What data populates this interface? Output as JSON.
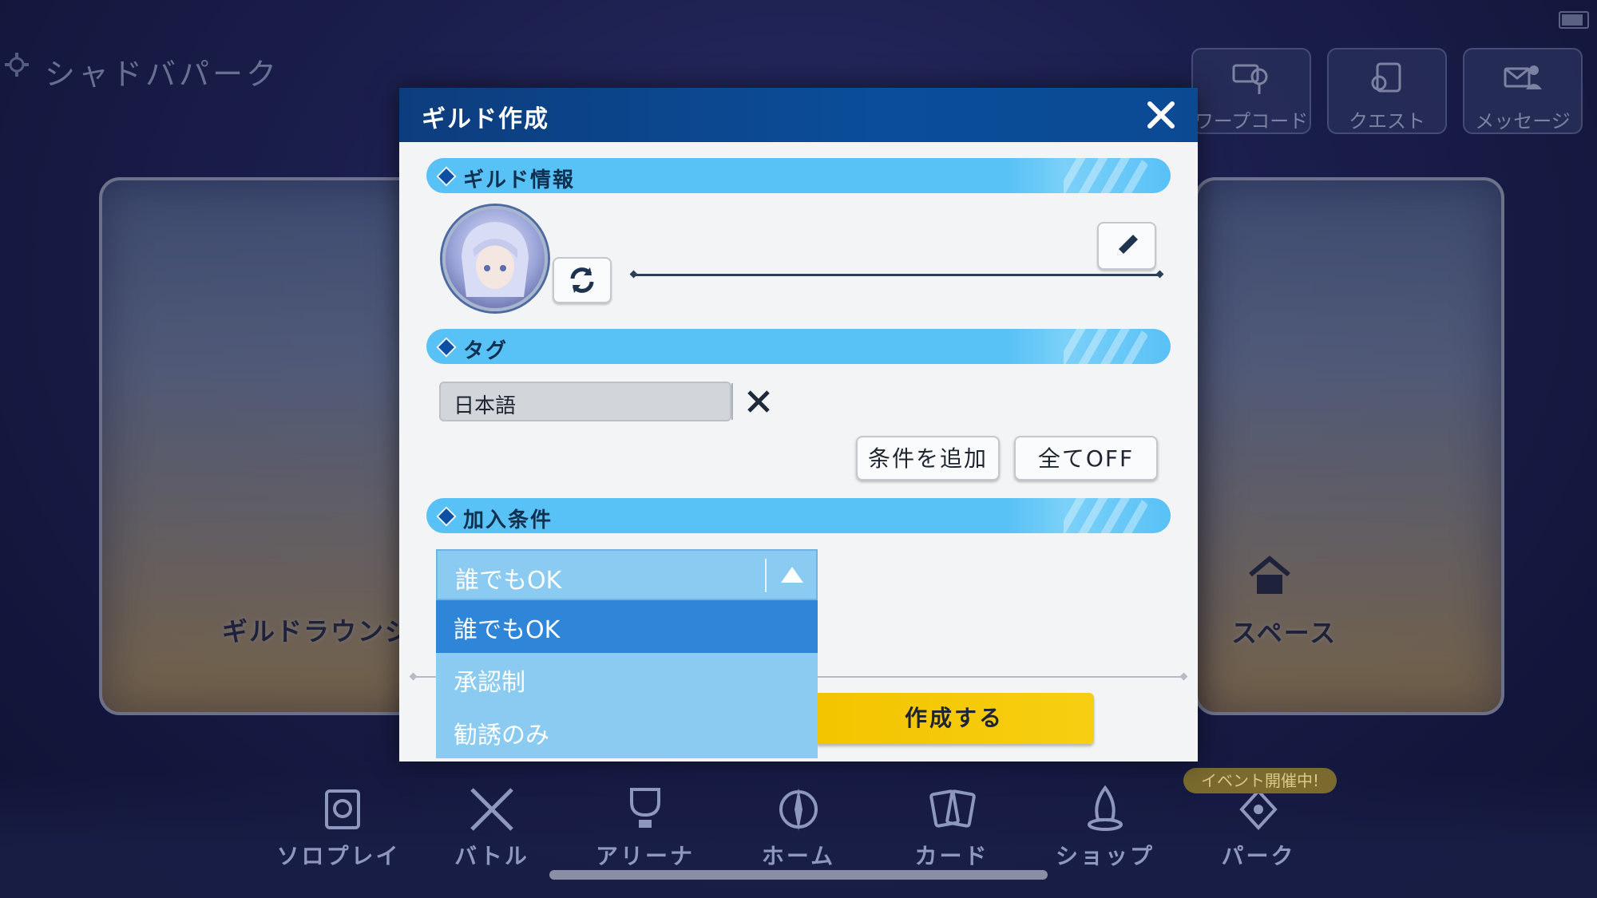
{
  "background": {
    "park_title": "シャドバパーク",
    "top_buttons": [
      {
        "label": "ワープコード",
        "icon": "map-pin-icon"
      },
      {
        "label": "クエスト",
        "icon": "quest-icon"
      },
      {
        "label": "メッセージ",
        "icon": "message-icon"
      }
    ],
    "panel_left_label": "ギルドラウンジ",
    "panel_right_label": "スペース",
    "event_badge": "イベント開催中!",
    "nav": [
      {
        "label": "ソロプレイ",
        "icon": "solo-play-icon"
      },
      {
        "label": "バトル",
        "icon": "battle-swords-icon"
      },
      {
        "label": "アリーナ",
        "icon": "arena-trophy-icon"
      },
      {
        "label": "ホーム",
        "icon": "home-compass-icon"
      },
      {
        "label": "カード",
        "icon": "cards-icon"
      },
      {
        "label": "ショップ",
        "icon": "shop-icon"
      },
      {
        "label": "パーク",
        "icon": "park-icon"
      }
    ]
  },
  "dialog": {
    "title": "ギルド作成",
    "sections": {
      "info": "ギルド情報",
      "tags": "タグ",
      "join": "加入条件"
    },
    "tag_chip": "日本語",
    "add_condition": "条件を追加",
    "all_off": "全てOFF",
    "create": "作成する",
    "dropdown": {
      "selected": "誰でもOK",
      "options": [
        "誰でもOK",
        "承認制",
        "勧誘のみ"
      ]
    }
  },
  "colors": {
    "header": "#0b4d9a",
    "section": "#58c1f6",
    "create": "#f7cf12",
    "dropdown": "#8bcbf1",
    "dropdown_selected": "#2f86d8"
  }
}
